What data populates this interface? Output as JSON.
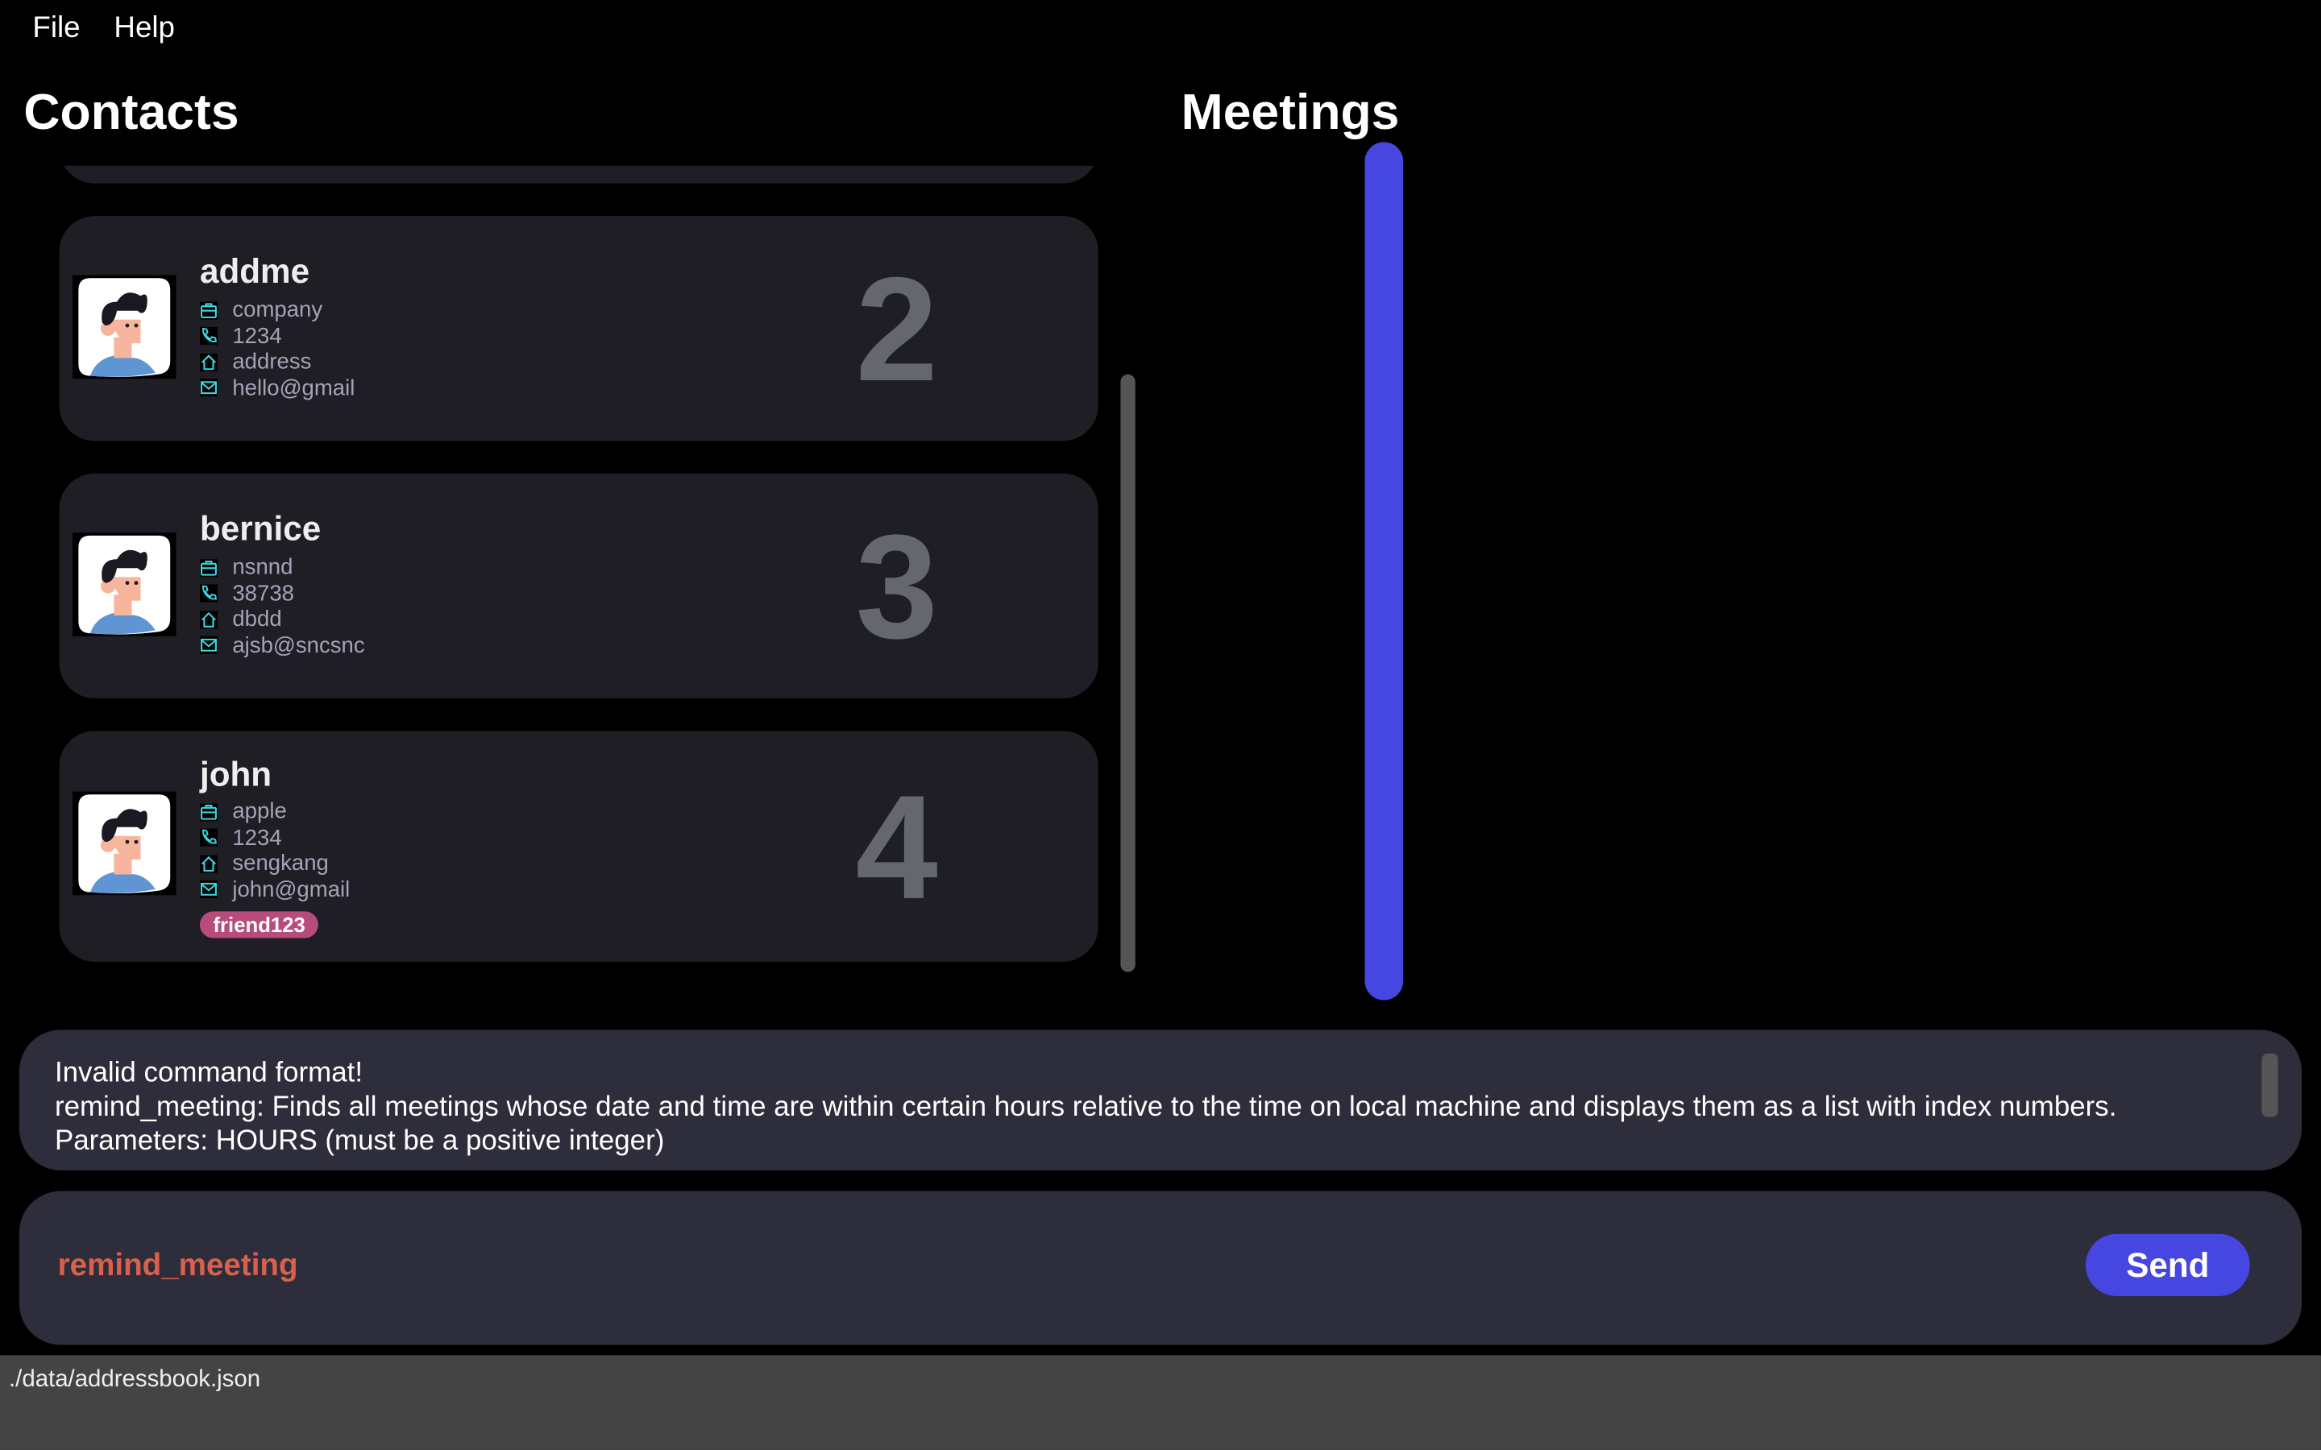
{
  "menu": {
    "file": "File",
    "help": "Help"
  },
  "contacts": {
    "title": "Contacts",
    "items": [
      {
        "index": "2",
        "name": "addme",
        "company": "company",
        "phone": "1234",
        "address": "address",
        "email": "hello@gmail",
        "tags": []
      },
      {
        "index": "3",
        "name": "bernice",
        "company": "nsnnd",
        "phone": "38738",
        "address": "dbdd",
        "email": "ajsb@sncsnc",
        "tags": []
      },
      {
        "index": "4",
        "name": "john",
        "company": "apple",
        "phone": "1234",
        "address": "sengkang",
        "email": "john@gmail",
        "tags": [
          "friend123"
        ]
      }
    ]
  },
  "meetings": {
    "title": "Meetings"
  },
  "result": {
    "lines": [
      "Invalid command format!",
      "remind_meeting: Finds all meetings whose date and time are within certain hours relative to the time on local machine and displays them as a list with index numbers.",
      "Parameters: HOURS (must be a positive integer)"
    ]
  },
  "command": {
    "value": "remind_meeting",
    "send_label": "Send"
  },
  "status": {
    "path": "./data/addressbook.json"
  },
  "colors": {
    "accent": "#4646e0",
    "command_text": "#d9604d",
    "tag": "#b84a7c",
    "icon": "#3ad8e0"
  }
}
